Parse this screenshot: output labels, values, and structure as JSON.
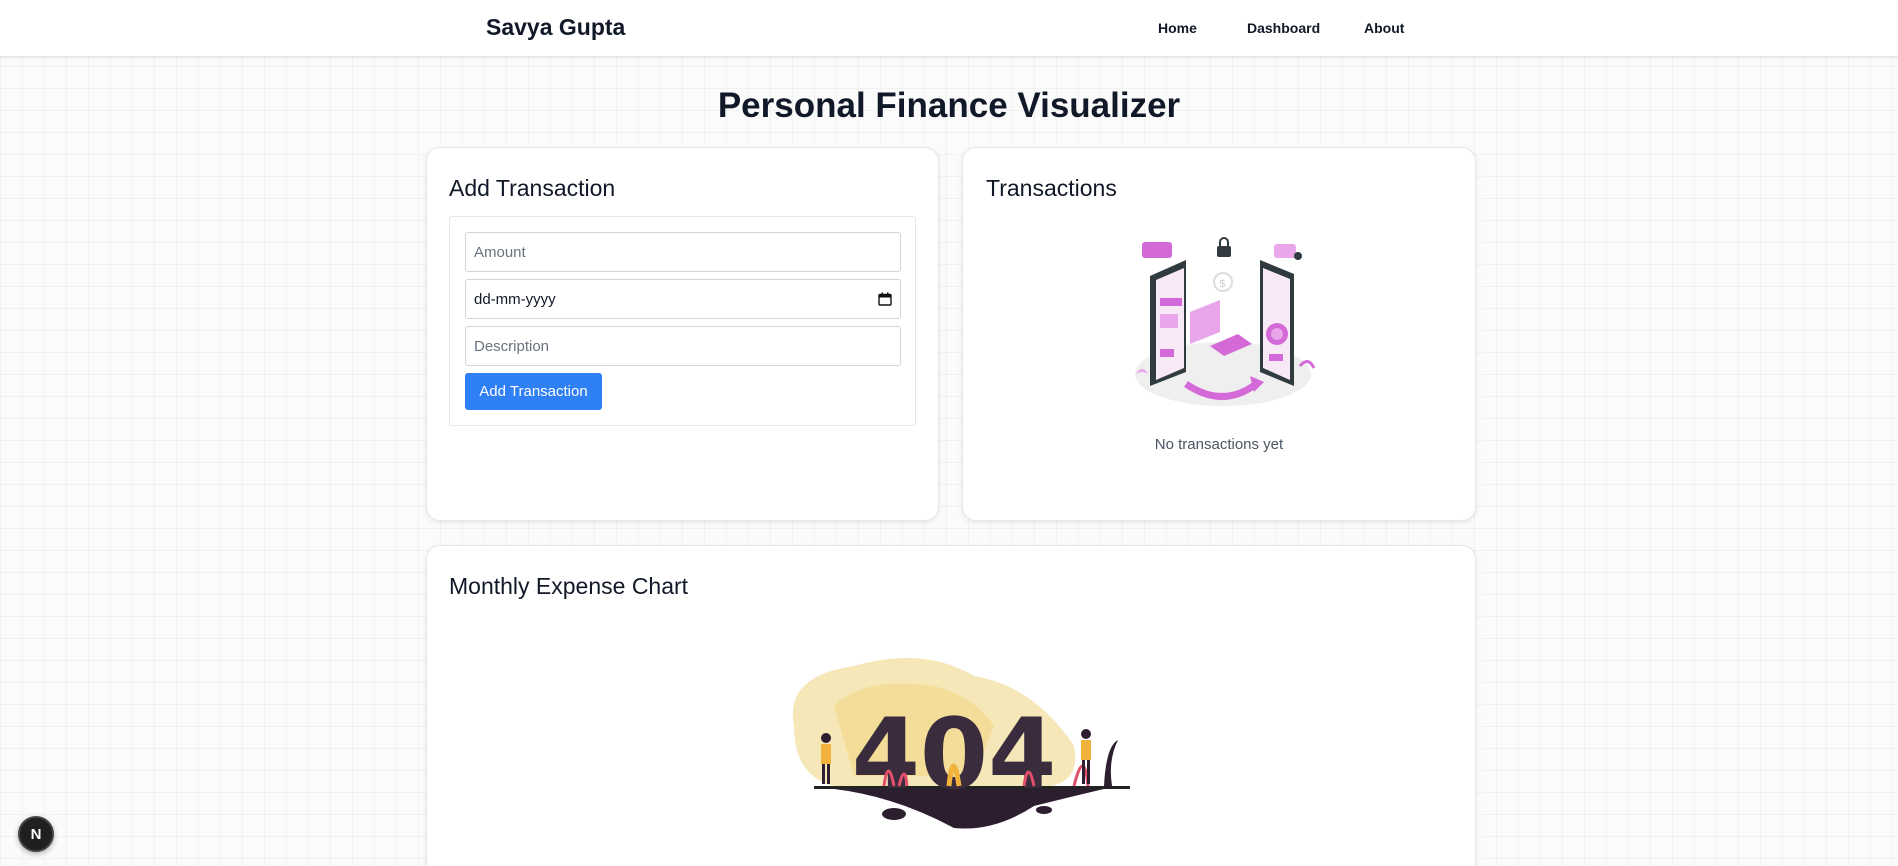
{
  "navbar": {
    "brand": "Savya Gupta",
    "links": [
      "Home",
      "Dashboard",
      "About"
    ]
  },
  "page_title": "Personal Finance Visualizer",
  "add_transaction": {
    "title": "Add Transaction",
    "amount_placeholder": "Amount",
    "date_placeholder": "dd-mm-yyyy",
    "description_placeholder": "Description",
    "button_label": "Add Transaction"
  },
  "transactions": {
    "title": "Transactions",
    "empty_text": "No transactions yet"
  },
  "chart_card": {
    "title": "Monthly Expense Chart",
    "illustration_text": "404"
  },
  "dev_badge": {
    "letter": "N"
  },
  "colors": {
    "accent": "#2f7ff5",
    "illustration_pink": "#d46ad8",
    "illustration_dark": "#2f3b3f",
    "illustration_yellow": "#f2d98b"
  }
}
